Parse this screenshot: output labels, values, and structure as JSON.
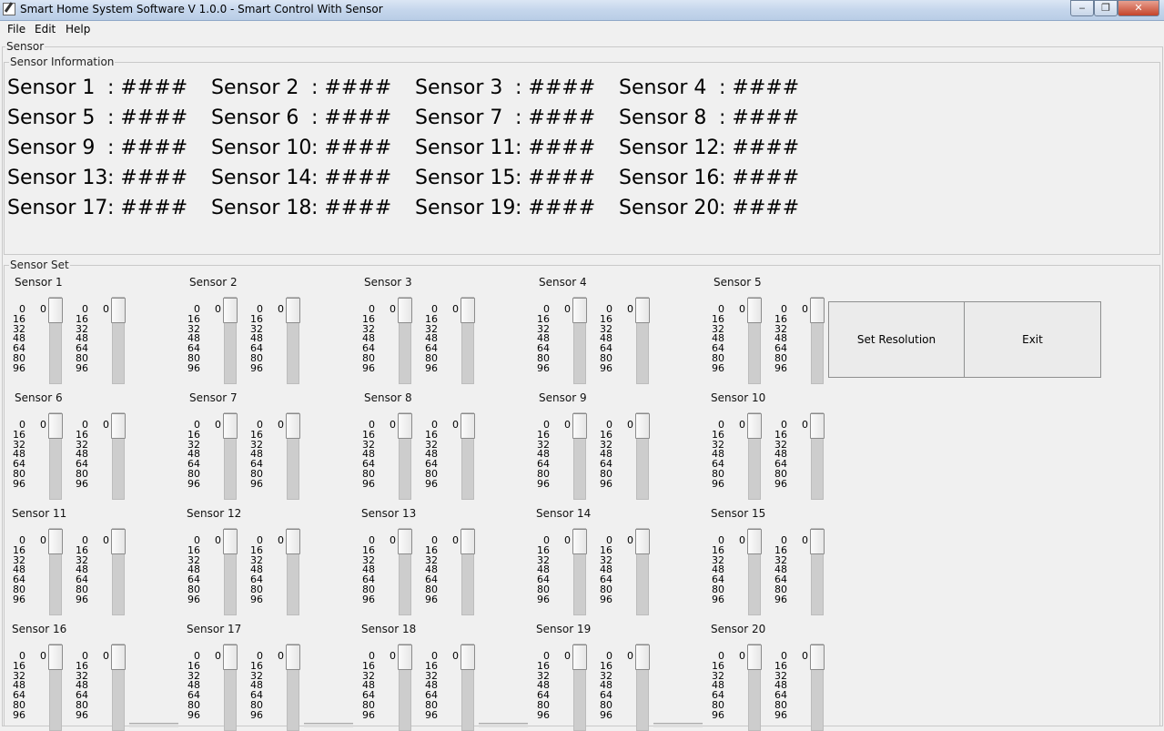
{
  "window": {
    "title": "Smart Home System Software V 1.0.0 - Smart Control With Sensor",
    "controls": {
      "minimize": "‒",
      "maximize": "❐",
      "close": "✕"
    }
  },
  "menu": [
    {
      "label": "File"
    },
    {
      "label": "Edit"
    },
    {
      "label": "Help"
    }
  ],
  "tab_label": "Sensor",
  "info_group": {
    "title": "Sensor Information",
    "rows": [
      [
        {
          "name": "Sensor 1",
          "value": ": ####"
        },
        {
          "name": "Sensor 2",
          "value": ": ####"
        },
        {
          "name": "Sensor 3",
          "value": ": ####"
        },
        {
          "name": "Sensor 4",
          "value": ": ####"
        }
      ],
      [
        {
          "name": "Sensor 5",
          "value": ": ####"
        },
        {
          "name": "Sensor 6",
          "value": ": ####"
        },
        {
          "name": "Sensor 7",
          "value": ": ####"
        },
        {
          "name": "Sensor 8",
          "value": ": ####"
        }
      ],
      [
        {
          "name": "Sensor 9",
          "value": ": ####"
        },
        {
          "name": "Sensor 10",
          "value": ": ####"
        },
        {
          "name": "Sensor 11",
          "value": ": ####"
        },
        {
          "name": "Sensor 12",
          "value": ": ####"
        }
      ],
      [
        {
          "name": "Sensor 13",
          "value": ": ####"
        },
        {
          "name": "Sensor 14",
          "value": ": ####"
        },
        {
          "name": "Sensor 15",
          "value": ": ####"
        },
        {
          "name": "Sensor 16",
          "value": ": ####"
        }
      ],
      [
        {
          "name": "Sensor 17",
          "value": ": ####"
        },
        {
          "name": "Sensor 18",
          "value": ": ####"
        },
        {
          "name": "Sensor 19",
          "value": ": ####"
        },
        {
          "name": "Sensor 20",
          "value": ": ####"
        }
      ]
    ]
  },
  "set_group": {
    "title": "Sensor Set",
    "scale_ticks": [
      "0",
      "16",
      "32",
      "48",
      "64",
      "80",
      "96"
    ],
    "sensors": [
      {
        "label": "Sensor 1",
        "slider_a": "0",
        "slider_b": "0"
      },
      {
        "label": "Sensor 2",
        "slider_a": "0",
        "slider_b": "0"
      },
      {
        "label": "Sensor 3",
        "slider_a": "0",
        "slider_b": "0"
      },
      {
        "label": "Sensor 4",
        "slider_a": "0",
        "slider_b": "0"
      },
      {
        "label": "Sensor 5",
        "slider_a": "0",
        "slider_b": "0"
      },
      {
        "label": "Sensor 6",
        "slider_a": "0",
        "slider_b": "0"
      },
      {
        "label": "Sensor 7",
        "slider_a": "0",
        "slider_b": "0"
      },
      {
        "label": "Sensor 8",
        "slider_a": "0",
        "slider_b": "0"
      },
      {
        "label": "Sensor 9",
        "slider_a": "0",
        "slider_b": "0"
      },
      {
        "label": "Sensor 10",
        "slider_a": "0",
        "slider_b": "0"
      },
      {
        "label": "Sensor 11",
        "slider_a": "0",
        "slider_b": "0"
      },
      {
        "label": "Sensor 12",
        "slider_a": "0",
        "slider_b": "0"
      },
      {
        "label": "Sensor 13",
        "slider_a": "0",
        "slider_b": "0"
      },
      {
        "label": "Sensor 14",
        "slider_a": "0",
        "slider_b": "0"
      },
      {
        "label": "Sensor 15",
        "slider_a": "0",
        "slider_b": "0"
      },
      {
        "label": "Sensor 16",
        "slider_a": "0",
        "slider_b": "0"
      },
      {
        "label": "Sensor 17",
        "slider_a": "0",
        "slider_b": "0"
      },
      {
        "label": "Sensor 18",
        "slider_a": "0",
        "slider_b": "0"
      },
      {
        "label": "Sensor 19",
        "slider_a": "0",
        "slider_b": "0"
      },
      {
        "label": "Sensor 20",
        "slider_a": "0",
        "slider_b": "0"
      }
    ],
    "buttons": {
      "set_resolution": "Set Resolution",
      "exit": "Exit"
    }
  }
}
